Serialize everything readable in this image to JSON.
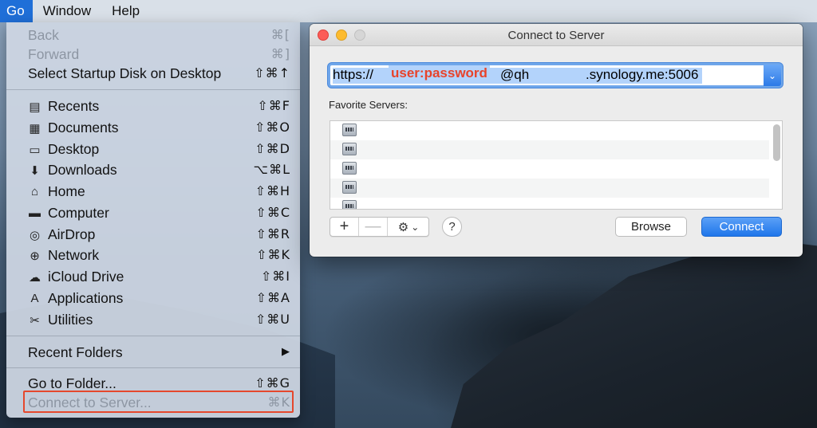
{
  "menubar": {
    "items": [
      {
        "label": "Go",
        "active": true
      },
      {
        "label": "Window"
      },
      {
        "label": "Help"
      }
    ]
  },
  "go_menu": {
    "items": [
      {
        "label": "Back",
        "shortcut": "⌘[",
        "enabled": false
      },
      {
        "label": "Forward",
        "shortcut": "⌘]",
        "enabled": false
      },
      {
        "label": "Select Startup Disk on Desktop",
        "shortcut": "⇧⌘↑",
        "enabled": true
      },
      {
        "label": "Recents",
        "shortcut": "⇧⌘F",
        "icon": "recents-icon"
      },
      {
        "label": "Documents",
        "shortcut": "⇧⌘O",
        "icon": "documents-icon"
      },
      {
        "label": "Desktop",
        "shortcut": "⇧⌘D",
        "icon": "desktop-icon"
      },
      {
        "label": "Downloads",
        "shortcut": "⌥⌘L",
        "icon": "downloads-icon"
      },
      {
        "label": "Home",
        "shortcut": "⇧⌘H",
        "icon": "home-icon"
      },
      {
        "label": "Computer",
        "shortcut": "⇧⌘C",
        "icon": "computer-icon"
      },
      {
        "label": "AirDrop",
        "shortcut": "⇧⌘R",
        "icon": "airdrop-icon"
      },
      {
        "label": "Network",
        "shortcut": "⇧⌘K",
        "icon": "network-icon"
      },
      {
        "label": "iCloud Drive",
        "shortcut": "⇧⌘I",
        "icon": "icloud-icon"
      },
      {
        "label": "Applications",
        "shortcut": "⇧⌘A",
        "icon": "applications-icon"
      },
      {
        "label": "Utilities",
        "shortcut": "⇧⌘U",
        "icon": "utilities-icon"
      },
      {
        "label": "Recent Folders",
        "submenu_arrow": "▶"
      },
      {
        "label": "Go to Folder...",
        "shortcut": "⇧⌘G",
        "enabled": true
      },
      {
        "label": "Connect to Server...",
        "shortcut": "⌘K",
        "enabled": false,
        "highlighted": true
      }
    ]
  },
  "dialog": {
    "title": "Connect to Server",
    "url": {
      "prefix": "https://",
      "credentials": "user:password",
      "host_part1": "@qh",
      "host_part2": ".synology.me:5006"
    },
    "favorites_label": "Favorite Servers:",
    "favorites_count_visible": 5,
    "buttons": {
      "add": "+",
      "remove": "—",
      "gear_arrow": "⌄",
      "help": "?",
      "browse": "Browse",
      "connect": "Connect"
    }
  },
  "colors": {
    "accent": "#1f6fd8",
    "highlight_box": "#e5482d",
    "credentials_text": "#e8432a"
  }
}
